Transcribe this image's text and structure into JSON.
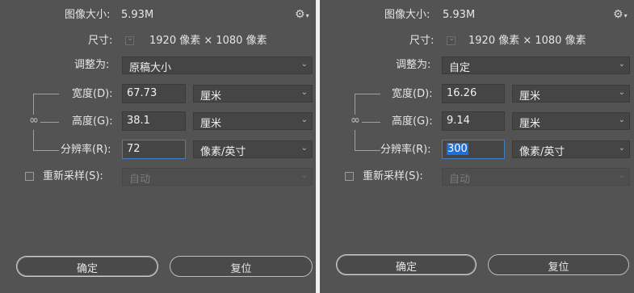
{
  "left": {
    "image_size_label": "图像大小:",
    "image_size_value": "5.93M",
    "dimensions_label": "尺寸:",
    "dimensions_value": "1920 像素 × 1080 像素",
    "fit_to_label": "调整为:",
    "fit_to_value": "原稿大小",
    "width_label": "宽度(D):",
    "width_value": "67.73",
    "width_unit": "厘米",
    "height_label": "高度(G):",
    "height_value": "38.1",
    "height_unit": "厘米",
    "resolution_label": "分辨率(R):",
    "resolution_value": "72",
    "resolution_unit": "像素/英寸",
    "resample_label": "重新采样(S):",
    "resample_value": "自动",
    "ok_label": "确定",
    "reset_label": "复位"
  },
  "right": {
    "image_size_label": "图像大小:",
    "image_size_value": "5.93M",
    "dimensions_label": "尺寸:",
    "dimensions_value": "1920 像素 × 1080 像素",
    "fit_to_label": "调整为:",
    "fit_to_value": "自定",
    "width_label": "宽度(D):",
    "width_value": "16.26",
    "width_unit": "厘米",
    "height_label": "高度(G):",
    "height_value": "9.14",
    "height_unit": "厘米",
    "resolution_label": "分辨率(R):",
    "resolution_value": "300",
    "resolution_unit": "像素/英寸",
    "resample_label": "重新采样(S):",
    "resample_value": "自动",
    "ok_label": "确定",
    "reset_label": "复位"
  },
  "icons": {
    "settings": "gear-icon",
    "dropdown": "chevron-down-icon",
    "constrain": "link-icon"
  }
}
